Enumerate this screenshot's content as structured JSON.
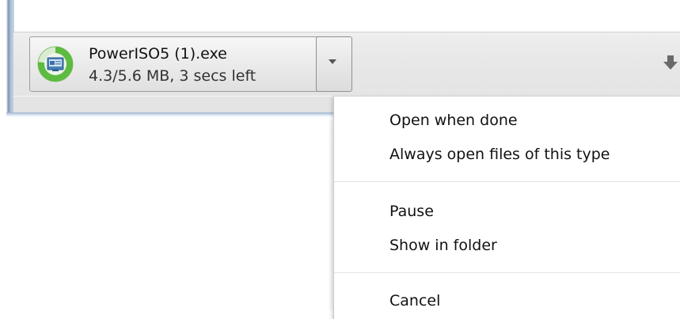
{
  "download": {
    "file_name": "PowerISO5 (1).exe",
    "status": "4.3/5.6 MB, 3 secs left",
    "progress": 0.77,
    "icon": "installer-icon"
  },
  "shelf": {
    "dropdown_icon": "chevron-down-icon",
    "arrow_icon": "download-arrow-icon"
  },
  "menu": {
    "items": [
      {
        "label": "Open when done"
      },
      {
        "label": "Always open files of this type"
      },
      {
        "label": "Pause"
      },
      {
        "label": "Show in folder"
      },
      {
        "label": "Cancel"
      }
    ]
  },
  "colors": {
    "progress_green": "#5dbb3f",
    "menu_background": "#ffffff",
    "shelf_background": "#e7e7e7"
  }
}
